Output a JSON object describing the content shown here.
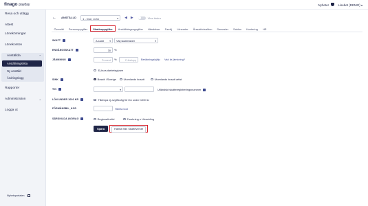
{
  "header": {
    "logo_brand": "finago",
    "logo_product": "payday",
    "news_label": "Nyheter",
    "user_label": "Lisebet (DEMO)"
  },
  "sidebar": {
    "items": [
      {
        "label": "Resa och utlägg"
      },
      {
        "label": "Attest"
      },
      {
        "label": "Lönekörningar"
      },
      {
        "label": "Lönekonton"
      },
      {
        "label": "Anställda"
      },
      {
        "label": "Rapporter"
      },
      {
        "label": "Administration"
      },
      {
        "label": "Logga ut"
      }
    ],
    "sub_items": [
      {
        "label": "Anställningslista"
      },
      {
        "label": "Ny anställd"
      },
      {
        "label": "Ändringslogg"
      }
    ],
    "news_portal": "Nyhetsportalen"
  },
  "employee_bar": {
    "label": "ANSTÄLLD",
    "selected": "1 - Doe, John",
    "toggle_label": "Visa ändra"
  },
  "tabs": [
    {
      "label": "Översikt"
    },
    {
      "label": "Personuppgifter"
    },
    {
      "label": "Skatteuppgifter"
    },
    {
      "label": "Anställningsuppgifter"
    },
    {
      "label": "Händelser"
    },
    {
      "label": "Familj"
    },
    {
      "label": "Lönearter"
    },
    {
      "label": "Årssaldo/saldon"
    },
    {
      "label": "Semester"
    },
    {
      "label": "Saldon"
    },
    {
      "label": "Kontering"
    },
    {
      "label": "HR"
    }
  ],
  "form": {
    "skatt": {
      "label": "SKATT",
      "type_value": "A-skatt",
      "table_placeholder": "Välj skattetabell"
    },
    "engangsskatt": {
      "label": "ENGÅNGSSKATT",
      "value": "30",
      "unit": "%"
    },
    "jamkning": {
      "label": "JÄMKNING",
      "percent_placeholder": "Procent",
      "percent_unit": "%",
      "amount_placeholder": "Fribelopp",
      "link_calc": "Beräkningshjälp",
      "link_what": "Vad är jämkning?",
      "checkbox_label": "Ej huvudarbetsgivare"
    },
    "sink": {
      "label": "SINK",
      "options": [
        "Bosatt i Sverige",
        "Utomlands bosatt",
        "Utomlands bosatt artist"
      ]
    },
    "tin": {
      "label": "TIN",
      "country_placeholder": "",
      "number_placeholder": "",
      "help_text": "Utländskt skatteregistreringsnummer"
    },
    "lon_under": {
      "label": "LÖN UNDER 1000 KR",
      "checkbox_label": "Tillämpa ej avgiftsväg för lön under 1000 kr"
    },
    "forman": {
      "label": "FÖRMÅNSBIL_KOD",
      "value": "",
      "link": "Hämta kod"
    },
    "sarskilda": {
      "label": "SÄRSKILDA AVDRAG",
      "options": [
        "Regionalt stöd",
        "Forskning o Utveckling"
      ]
    }
  },
  "buttons": {
    "save": "Spara",
    "fetch": "Hämta från Skatteverket"
  },
  "colors": {
    "navy": "#1f2547",
    "highlight": "#d8252e",
    "sidebar_bg": "#f2f4f8"
  }
}
